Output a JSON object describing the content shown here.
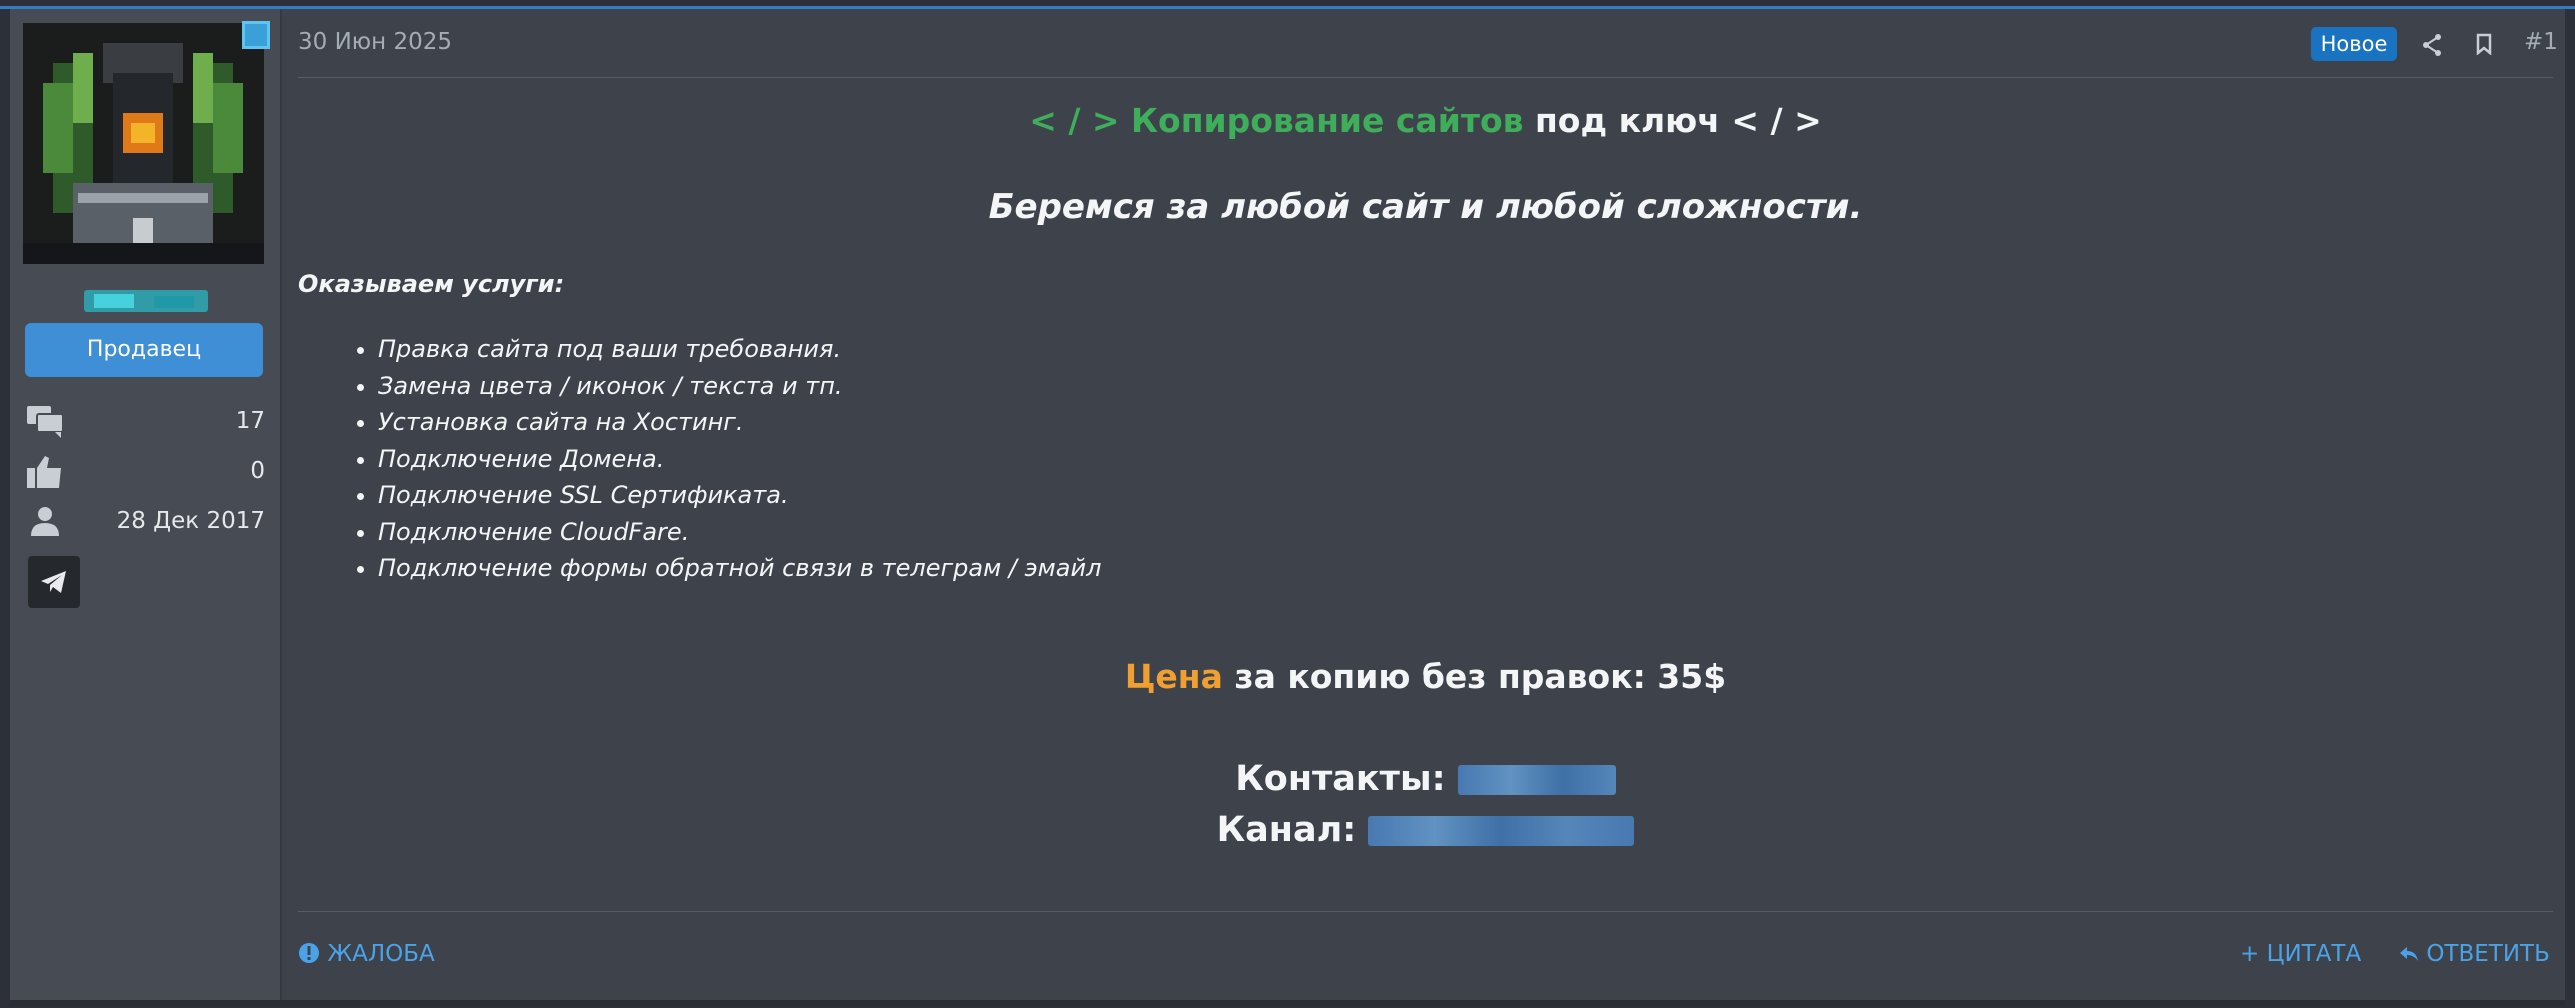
{
  "post": {
    "date": "30 Июн 2025",
    "new_badge": "Новое",
    "post_number": "#1",
    "icons": {
      "share": "share-icon",
      "bookmark": "bookmark-icon"
    }
  },
  "author": {
    "role_button": "Продавец",
    "stats": [
      {
        "icon": "messages-icon",
        "value": "17"
      },
      {
        "icon": "thumbs-up-icon",
        "value": "0"
      },
      {
        "icon": "user-icon",
        "value": "28 Дек 2017"
      }
    ],
    "contact_icon": "telegram-icon"
  },
  "content": {
    "title_prefix": "< / > Копирование сайтов",
    "title_suffix": "под ключ < / >",
    "subtitle": "Беремся за любой сайт и любой сложности.",
    "services_label": "Оказываем услуги:",
    "services": [
      "Правка сайта под ваши требования.",
      "Замена цвета / иконок / текста и тп.",
      "Установка сайта на Хостинг.",
      "Подключение Домена.",
      "Подключение SSL Сертификата.",
      "Подключение CloudFare.",
      "Подключение формы обратной связи в телеграм / эмайл"
    ],
    "price_word": "Цена",
    "price_rest": "за копию без правок: 35$",
    "contacts_label": "Контакты:",
    "channel_label": "Канал:"
  },
  "footer": {
    "report": "ЖАЛОБА",
    "quote": "+ ЦИТАТА",
    "reply": "ОТВЕТИТЬ"
  },
  "colors": {
    "accent": "#1a73c0",
    "link": "#4aa3e8",
    "green_title": "#3fae5a",
    "orange_price": "#f0a030"
  }
}
